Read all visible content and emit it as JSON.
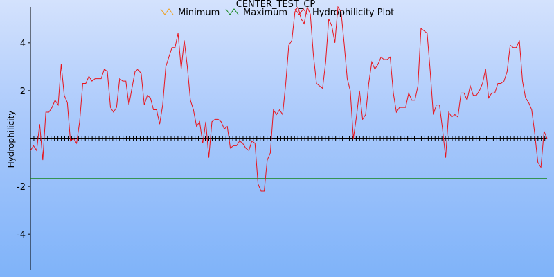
{
  "chart_data": {
    "type": "line",
    "title": "CENTER_TEST_CP",
    "ylabel": "Hydrophilicity",
    "xlabel": "",
    "ylim": [
      -5.5,
      5.5
    ],
    "xlim": [
      0,
      226
    ],
    "y_ticks": [
      -4,
      -2,
      2,
      4
    ],
    "y_tick_labels": [
      "-4",
      "-2",
      "2",
      "4"
    ],
    "grid": false,
    "legend_position": "top-center",
    "series": [
      {
        "name": "Minimum",
        "color": "#f0a01e",
        "y_constant": -2.07
      },
      {
        "name": "Maximum",
        "color": "#14861c",
        "y_constant": -1.67
      },
      {
        "name": "Hydrophilicity Plot",
        "color": "#e8141c",
        "y": [
          -0.5,
          -0.3,
          -0.5,
          0.6,
          -0.9,
          1.1,
          1.1,
          1.3,
          1.6,
          1.4,
          3.1,
          1.8,
          1.5,
          -0.1,
          0.0,
          -0.2,
          0.7,
          2.3,
          2.3,
          2.6,
          2.4,
          2.5,
          2.5,
          2.5,
          2.9,
          2.8,
          1.3,
          1.1,
          1.3,
          2.5,
          2.4,
          2.4,
          1.4,
          2.1,
          2.8,
          2.9,
          2.7,
          1.4,
          1.8,
          1.7,
          1.2,
          1.2,
          0.6,
          1.4,
          3.0,
          3.4,
          3.8,
          3.8,
          4.4,
          2.9,
          4.1,
          3.0,
          1.6,
          1.2,
          0.5,
          0.7,
          -0.2,
          0.7,
          -0.8,
          0.7,
          0.8,
          0.8,
          0.7,
          0.4,
          0.5,
          -0.4,
          -0.3,
          -0.3,
          -0.1,
          -0.2,
          -0.4,
          -0.5,
          -0.1,
          -0.2,
          -1.9,
          -2.2,
          -2.2,
          -0.9,
          -0.6,
          1.2,
          1.0,
          1.2,
          1.0,
          2.3,
          3.9,
          4.1,
          5.3,
          5.5,
          5.0,
          4.8,
          5.5,
          5.2,
          3.5,
          2.3,
          2.2,
          2.1,
          3.2,
          5.0,
          4.7,
          4.0,
          5.5,
          5.3,
          4.0,
          2.5,
          2.0,
          0.0,
          0.9,
          2.0,
          0.8,
          1.0,
          2.3,
          3.2,
          2.9,
          3.1,
          3.4,
          3.3,
          3.3,
          3.4,
          1.9,
          1.1,
          1.3,
          1.3,
          1.3,
          1.9,
          1.6,
          1.6,
          2.2,
          4.6,
          4.5,
          4.4,
          2.8,
          1.0,
          1.4,
          1.4,
          0.4,
          -0.8,
          1.1,
          0.9,
          1.0,
          0.9,
          1.9,
          1.9,
          1.6,
          2.2,
          1.8,
          1.8,
          2.0,
          2.3,
          2.9,
          1.7,
          1.9,
          1.9,
          2.3,
          2.3,
          2.4,
          2.8,
          3.9,
          3.8,
          3.8,
          4.1,
          2.4,
          1.7,
          1.5,
          1.2,
          0.2,
          -1.0,
          -1.2,
          0.3,
          0.0
        ]
      }
    ]
  }
}
